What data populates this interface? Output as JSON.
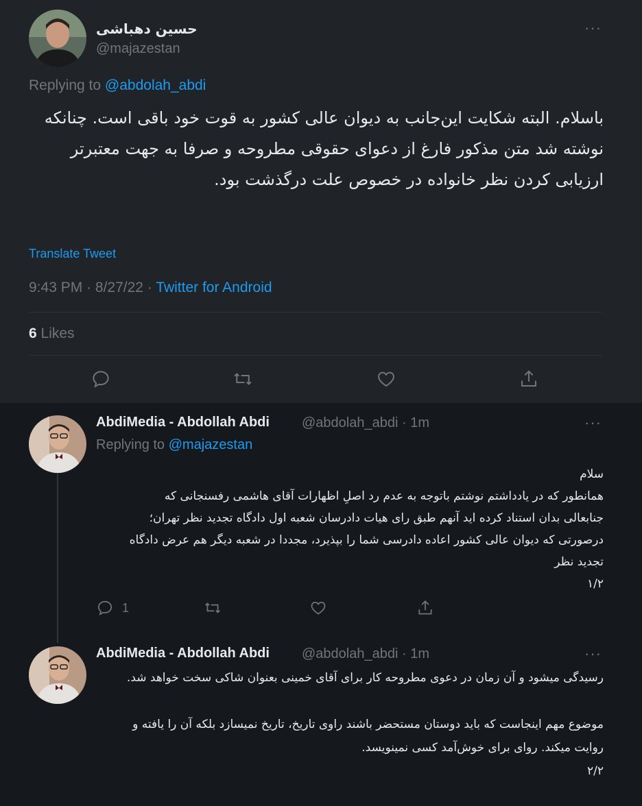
{
  "main_tweet": {
    "author_name": "حسین دهباشی",
    "author_handle": "@majazestan",
    "replying_prefix": "Replying to",
    "replying_to": "@abdolah_abdi",
    "text": "باسلام. البته شکایت این‌جانب به دیوان عالی کشور به قوت خود باقی است. چنانکه نوشته شد متن مذکور فارغ از دعوای حقوقی مطروحه و صرفا به جهت معتبرتر ارزیابی کردن نظر خانواده در خصوص علت درگذشت بود.",
    "translate_label": "Translate Tweet",
    "time": "9:43 PM",
    "date": "8/27/22",
    "separator": "·",
    "source": "Twitter for Android",
    "likes_count": "6",
    "likes_label": "Likes"
  },
  "replies": [
    {
      "author_name": "AbdiMedia - Abdollah Abdi",
      "author_handle": "@abdolah_abdi",
      "time_ago": "· 1m",
      "replying_prefix": "Replying to",
      "replying_to": "@majazestan",
      "text": "سلام\nهمانطور که در یادداشتم نوشتم باتوجه به عدم رد اصلِ اظهارات آقای هاشمی رفسنجانی که جنابعالی بدان استناد کرده اید آنهم طبق رای هیات دادرسان شعبه اول دادگاه تجدید نظر تهران؛ درصورتی که دیوان عالی کشور اعاده دادرسی شما را بپذیرد، مجددا در شعبه دیگر هم عرض دادگاه تجدید نظر\n۱/۲",
      "reply_count": "1"
    },
    {
      "author_name": "AbdiMedia - Abdollah Abdi",
      "author_handle": "@abdolah_abdi",
      "time_ago": "· 1m",
      "text": "رسیدگی میشود و آن زمان در دعوی مطروحه کار برای آقای خمینی بعنوان شاکی سخت خواهد شد.\n\nموضوع مهم اینجاست که باید دوستان  مستحضر باشند راوی تاریخ، تاریخ نمیسازد بلکه آن را یافته و روایت میکند. روای برای خوش‌آمد کسی نمینویسد.\n۲/۲"
    }
  ],
  "more_label": "···",
  "colors": {
    "accent": "#1d9bf0",
    "main_bg": "#202327",
    "reply_bg": "#15181c",
    "muted": "#71767b"
  },
  "icons": [
    "reply-icon",
    "retweet-icon",
    "like-icon",
    "share-icon",
    "more-icon"
  ]
}
